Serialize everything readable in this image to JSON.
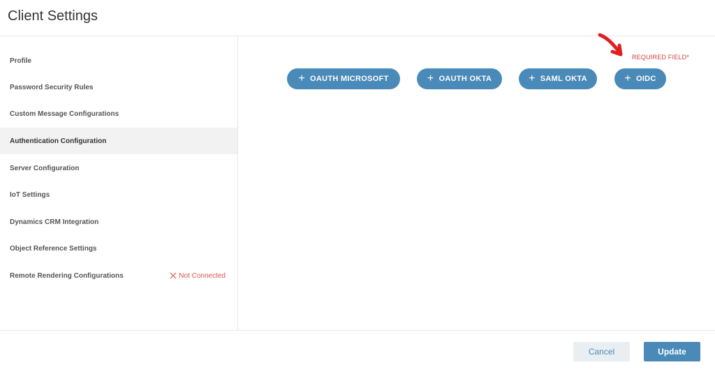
{
  "header": {
    "title": "Client Settings"
  },
  "sidebar": {
    "items": [
      {
        "label": "Profile"
      },
      {
        "label": "Password Security Rules"
      },
      {
        "label": "Custom Message Configurations"
      },
      {
        "label": "Authentication Configuration"
      },
      {
        "label": "Server Configuration"
      },
      {
        "label": "IoT Settings"
      },
      {
        "label": "Dynamics CRM Integration"
      },
      {
        "label": "Object Reference Settings"
      },
      {
        "label": "Remote Rendering Configurations",
        "status": "Not Connected"
      }
    ],
    "active": "Authentication Configuration"
  },
  "main": {
    "required_label": "REQUIRED FIELD*",
    "buttons": [
      {
        "label": "OAUTH MICROSOFT"
      },
      {
        "label": "OAUTH OKTA"
      },
      {
        "label": "SAML OKTA"
      },
      {
        "label": "OIDC"
      }
    ]
  },
  "footer": {
    "cancel_label": "Cancel",
    "update_label": "Update"
  },
  "colors": {
    "accent": "#4a8ab8",
    "error": "#d9534f",
    "annotation": "#e02020"
  },
  "icons": {
    "add": "plus-icon",
    "status": "x-icon",
    "annotation": "red-arrow-icon"
  }
}
